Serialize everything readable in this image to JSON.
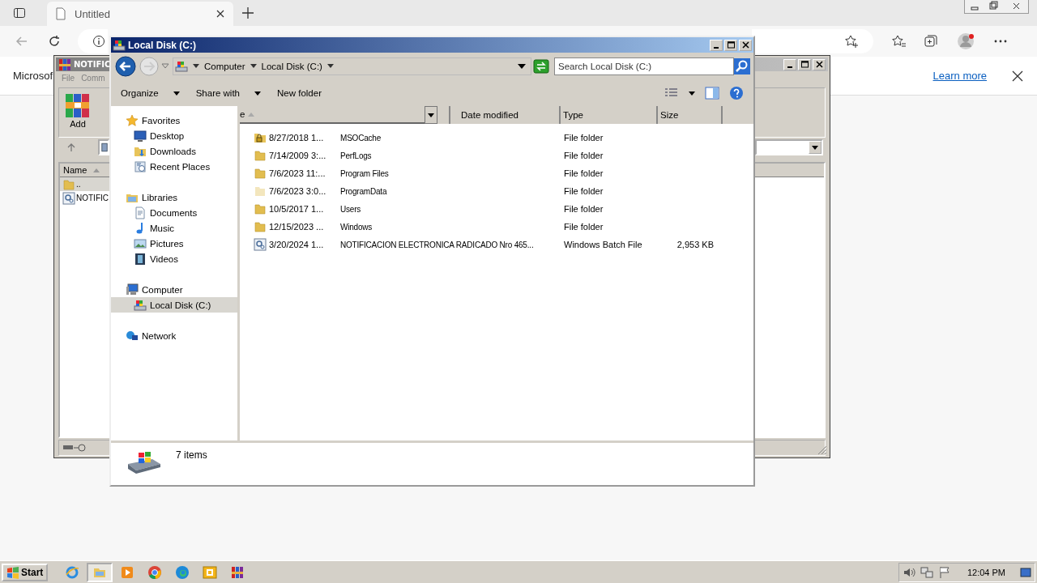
{
  "browser": {
    "tabs": [
      {
        "title": "Untitled",
        "selected": true
      }
    ],
    "infobar": {
      "text": "Microsof",
      "link": "Learn more"
    }
  },
  "winrar": {
    "title": "NOTIFIC",
    "menu": [
      "File",
      "Comm"
    ],
    "toolbar": [
      "Add"
    ],
    "columns": [
      "Name"
    ],
    "rows": [
      {
        "name": "..",
        "kind": "parent"
      },
      {
        "name": "NOTIFIC",
        "kind": "batch-file"
      }
    ]
  },
  "explorer": {
    "title": "Local Disk (C:)",
    "breadcrumb": [
      "Computer",
      "Local Disk (C:)"
    ],
    "search": {
      "placeholder": "Search Local Disk (C:)"
    },
    "commands": [
      {
        "label": "Organize",
        "menu": true
      },
      {
        "label": "Share with",
        "menu": true
      },
      {
        "label": "New folder",
        "menu": false
      }
    ],
    "nav": [
      {
        "label": "Favorites",
        "kind": "favorites",
        "selected": false,
        "children": [
          {
            "label": "Desktop",
            "kind": "desktop",
            "selected": false
          },
          {
            "label": "Downloads",
            "kind": "downloads",
            "selected": false
          },
          {
            "label": "Recent Places",
            "kind": "recent",
            "selected": false
          }
        ]
      },
      {
        "label": "Libraries",
        "kind": "libraries",
        "selected": false,
        "children": [
          {
            "label": "Documents",
            "kind": "documents",
            "selected": false
          },
          {
            "label": "Music",
            "kind": "music",
            "selected": false
          },
          {
            "label": "Pictures",
            "kind": "pictures",
            "selected": false
          },
          {
            "label": "Videos",
            "kind": "videos",
            "selected": false
          }
        ]
      },
      {
        "label": "Computer",
        "kind": "computer",
        "selected": false,
        "children": [
          {
            "label": "Local Disk (C:)",
            "kind": "drive",
            "selected": true
          }
        ]
      },
      {
        "label": "Network",
        "kind": "network",
        "selected": false
      }
    ],
    "columns": [
      "e",
      "Date modified",
      "Type",
      "Size"
    ],
    "rows": [
      {
        "date": "8/27/2018 1...",
        "name": "MSOCache",
        "type": "File folder",
        "kind": "locked-folder"
      },
      {
        "date": "7/14/2009 3:...",
        "name": "PerfLogs",
        "type": "File folder",
        "kind": "folder"
      },
      {
        "date": "7/6/2023 11:...",
        "name": "Program Files",
        "type": "File folder",
        "kind": "folder"
      },
      {
        "date": "7/6/2023 3:0...",
        "name": "ProgramData",
        "type": "File folder",
        "kind": "hidden-folder"
      },
      {
        "date": "10/5/2017 1...",
        "name": "Users",
        "type": "File folder",
        "kind": "folder"
      },
      {
        "date": "12/15/2023 ...",
        "name": "Windows",
        "type": "File folder",
        "kind": "folder"
      },
      {
        "date": "3/20/2024 1...",
        "name": "NOTIFICACION ELECTRONICA RADICADO Nro 465...",
        "type": "Windows Batch File",
        "size": "2,953 KB",
        "kind": "batch-file"
      }
    ],
    "status": "7 items"
  },
  "taskbar": {
    "start": "Start",
    "apps": [
      {
        "kind": "ie",
        "selected": false
      },
      {
        "kind": "explorer",
        "selected": true
      },
      {
        "kind": "media",
        "selected": false
      },
      {
        "kind": "chrome",
        "selected": false
      },
      {
        "kind": "edge",
        "selected": false
      },
      {
        "kind": "outlook",
        "selected": false
      },
      {
        "kind": "winrar",
        "selected": false
      }
    ],
    "clock": "12:04 PM"
  }
}
